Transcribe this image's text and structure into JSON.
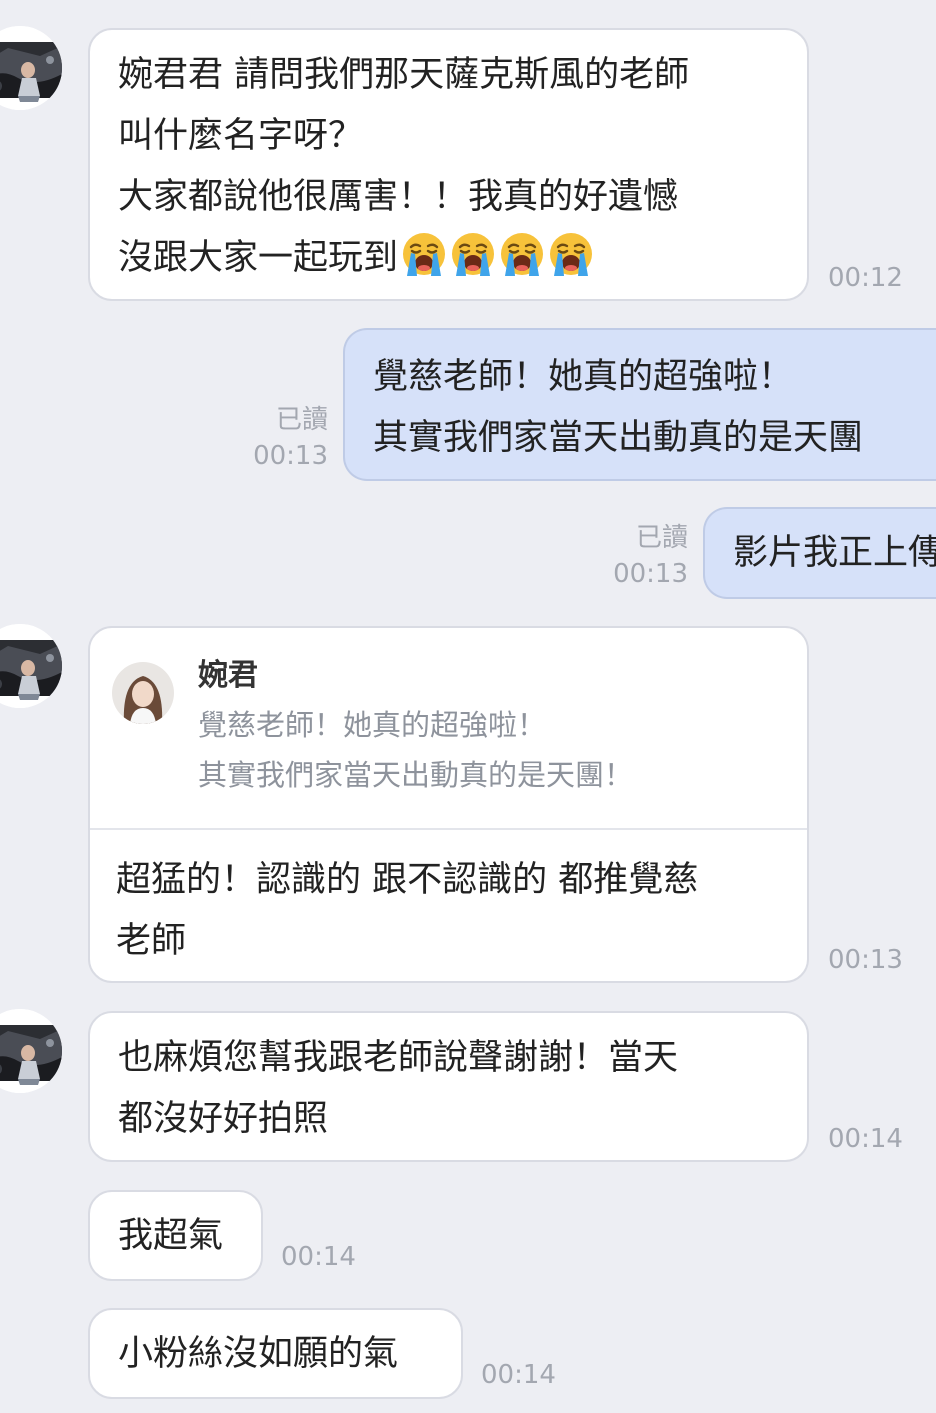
{
  "colors": {
    "background": "#edeef3",
    "incoming_bubble": "#ffffff",
    "outgoing_bubble": "#d6e1f9",
    "meta_text": "#a3a7b0"
  },
  "messages": {
    "m1": {
      "lines": [
        "婉君君 請問我們那天薩克斯風的老師",
        "叫什麼名字呀？",
        "大家都說他很厲害！！我真的好遺憾",
        "沒跟大家一起玩到"
      ],
      "emoji": "loudly-crying-face",
      "time": "00:12"
    },
    "m2": {
      "lines": [
        "覺慈老師！她真的超強啦！",
        "其實我們家當天出動真的是天團"
      ],
      "read": "已讀",
      "time": "00:13"
    },
    "m3": {
      "text": "影片我正上傳",
      "read": "已讀",
      "time": "00:13"
    },
    "m4": {
      "reply_name": "婉君",
      "reply_quote": [
        "覺慈老師！她真的超強啦！",
        "其實我們家當天出動真的是天團！"
      ],
      "lines": [
        "超猛的！認識的 跟不認識的 都推覺慈",
        "老師"
      ],
      "time": "00:13"
    },
    "m5": {
      "lines": [
        "也麻煩您幫我跟老師說聲謝謝！當天",
        "都沒好好拍照"
      ],
      "time": "00:14"
    },
    "m6": {
      "text": "我超氣",
      "time": "00:14"
    },
    "m7": {
      "text": "小粉絲沒如願的氣",
      "time": "00:14"
    }
  }
}
